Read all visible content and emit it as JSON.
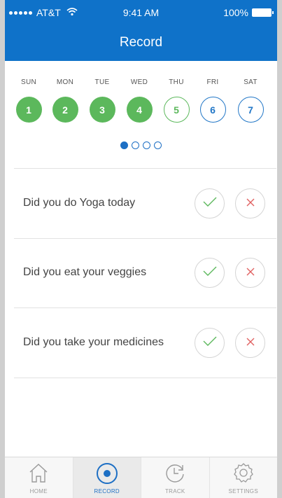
{
  "status_bar": {
    "carrier": "AT&T",
    "time": "9:41 AM",
    "battery": "100%"
  },
  "header": {
    "title": "Record"
  },
  "week": {
    "days": [
      {
        "name": "SUN",
        "number": "1",
        "state": "done"
      },
      {
        "name": "MON",
        "number": "2",
        "state": "done"
      },
      {
        "name": "TUE",
        "number": "3",
        "state": "done"
      },
      {
        "name": "WED",
        "number": "4",
        "state": "done"
      },
      {
        "name": "THU",
        "number": "5",
        "state": "today"
      },
      {
        "name": "FRI",
        "number": "6",
        "state": "future"
      },
      {
        "name": "SAT",
        "number": "7",
        "state": "future"
      }
    ],
    "page_dots": {
      "count": 4,
      "active_index": 0
    }
  },
  "questions": [
    {
      "text": "Did you do Yoga today",
      "yes_icon": "check-icon",
      "no_icon": "cross-icon"
    },
    {
      "text": "Did you eat your veggies",
      "yes_icon": "check-icon",
      "no_icon": "cross-icon"
    },
    {
      "text": "Did you take your medicines",
      "yes_icon": "check-icon",
      "no_icon": "cross-icon"
    }
  ],
  "tabs": [
    {
      "label": "HOME",
      "icon": "home-icon",
      "active": false
    },
    {
      "label": "RECORD",
      "icon": "record-icon",
      "active": true
    },
    {
      "label": "TRACK",
      "icon": "clock-icon",
      "active": false
    },
    {
      "label": "SETTINGS",
      "icon": "gear-icon",
      "active": false
    }
  ],
  "colors": {
    "header_bg": "#0f72c9",
    "done_green": "#5cb85c",
    "future_blue": "#2277c7",
    "yes_check": "#5cb85c",
    "no_cross": "#e06060"
  }
}
